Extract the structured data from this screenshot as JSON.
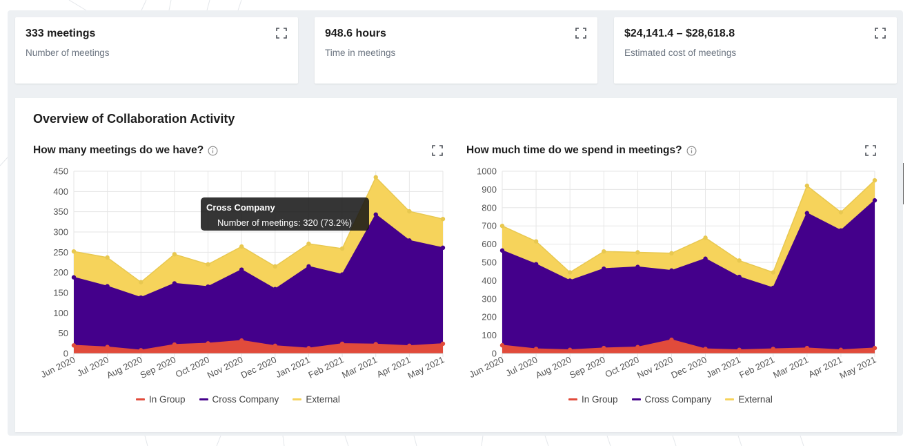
{
  "cards": [
    {
      "value": "333 meetings",
      "label": "Number of meetings"
    },
    {
      "value": "948.6 hours",
      "label": "Time in meetings"
    },
    {
      "value": "$24,141.4 – $28,618.8",
      "label": "Estimated cost of meetings"
    }
  ],
  "panel": {
    "title": "Overview of Collaboration Activity"
  },
  "charts": [
    {
      "title": "How many meetings do we have?"
    },
    {
      "title": "How much time do we spend in meetings?"
    }
  ],
  "legend": [
    {
      "label": "In Group",
      "color": "#e14b3b"
    },
    {
      "label": "Cross Company",
      "color": "#44008b"
    },
    {
      "label": "External",
      "color": "#f6d35b"
    }
  ],
  "tooltip": {
    "title": "Cross Company",
    "body": "Number of meetings: 320 (73.2%)"
  },
  "chart_data": [
    {
      "type": "area",
      "stacked": true,
      "title": "How many meetings do we have?",
      "categories": [
        "Jun 2020",
        "Jul 2020",
        "Aug 2020",
        "Sep 2020",
        "Oct 2020",
        "Nov 2020",
        "Dec 2020",
        "Jan 2021",
        "Feb 2021",
        "Mar 2021",
        "Apr 2021",
        "May 2021"
      ],
      "ylim": [
        0,
        450
      ],
      "yticks": [
        0,
        50,
        100,
        150,
        200,
        250,
        300,
        350,
        400,
        450
      ],
      "grid": true,
      "legend_position": "bottom",
      "series": [
        {
          "name": "In Group",
          "color": "#e14b3b",
          "values": [
            20,
            16,
            8,
            22,
            25,
            32,
            19,
            13,
            24,
            23,
            19,
            24
          ]
        },
        {
          "name": "Cross Company",
          "color": "#44008b",
          "values": [
            168,
            150,
            130,
            151,
            140,
            175,
            140,
            202,
            171,
            320,
            260,
            237
          ]
        },
        {
          "name": "External",
          "color": "#f6d35b",
          "values": [
            64,
            71,
            38,
            72,
            55,
            57,
            56,
            56,
            64,
            92,
            72,
            71
          ]
        }
      ]
    },
    {
      "type": "area",
      "stacked": true,
      "title": "How much time do we spend in meetings?",
      "categories": [
        "Jun 2020",
        "Jul 2020",
        "Aug 2020",
        "Sep 2020",
        "Oct 2020",
        "Nov 2020",
        "Dec 2020",
        "Jan 2021",
        "Feb 2021",
        "Mar 2021",
        "Apr 2021",
        "May 2021"
      ],
      "ylim": [
        0,
        1000
      ],
      "yticks": [
        0,
        100,
        200,
        300,
        400,
        500,
        600,
        700,
        800,
        900,
        1000
      ],
      "grid": true,
      "legend_position": "bottom",
      "series": [
        {
          "name": "In Group",
          "color": "#e14b3b",
          "values": [
            45,
            25,
            20,
            30,
            35,
            75,
            25,
            20,
            25,
            30,
            20,
            30
          ]
        },
        {
          "name": "Cross Company",
          "color": "#44008b",
          "values": [
            520,
            465,
            380,
            435,
            440,
            380,
            495,
            400,
            335,
            740,
            655,
            810
          ]
        },
        {
          "name": "External",
          "color": "#f6d35b",
          "values": [
            135,
            125,
            45,
            95,
            80,
            95,
            115,
            90,
            85,
            150,
            100,
            110
          ]
        }
      ]
    }
  ]
}
